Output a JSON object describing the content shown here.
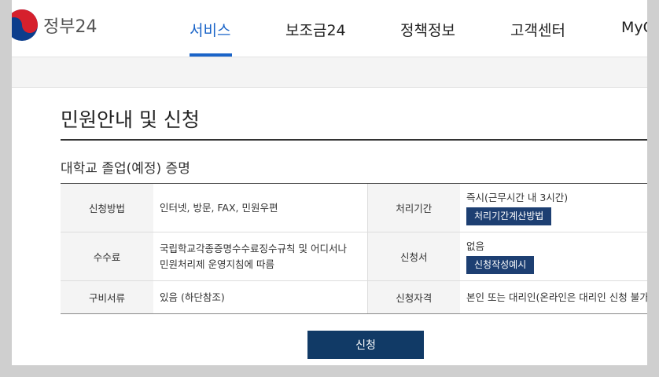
{
  "header": {
    "logo_text": "정부24",
    "nav": [
      "서비스",
      "보조금24",
      "정책정보",
      "고객센터",
      "MyGO"
    ]
  },
  "page": {
    "title": "민원안내 및 신청",
    "subtitle": "대학교 졸업(예정) 증명"
  },
  "table": {
    "rows": [
      {
        "label1": "신청방법",
        "value1": "인터넷, 방문, FAX, 민원우편",
        "label2": "처리기간",
        "value2": "즉시(근무시간 내 3시간)",
        "button2": "처리기간계산방법"
      },
      {
        "label1": "수수료",
        "value1_line1": "국립학교각종증명수수료징수규칙 및 어디서나",
        "value1_line2": "민원처리제 운영지침에 따름",
        "label2": "신청서",
        "value2": "없음",
        "button2": "신청작성예시"
      },
      {
        "label1": "구비서류",
        "value1": "있음 (하단참조)",
        "label2": "신청자격",
        "value2": "본인 또는 대리인(온라인은 대리인 신청 불가)"
      }
    ]
  },
  "apply_button": "신청",
  "colors": {
    "primary": "#1a64c8",
    "button_dark": "#113a66",
    "button_small": "#1d3f72"
  }
}
